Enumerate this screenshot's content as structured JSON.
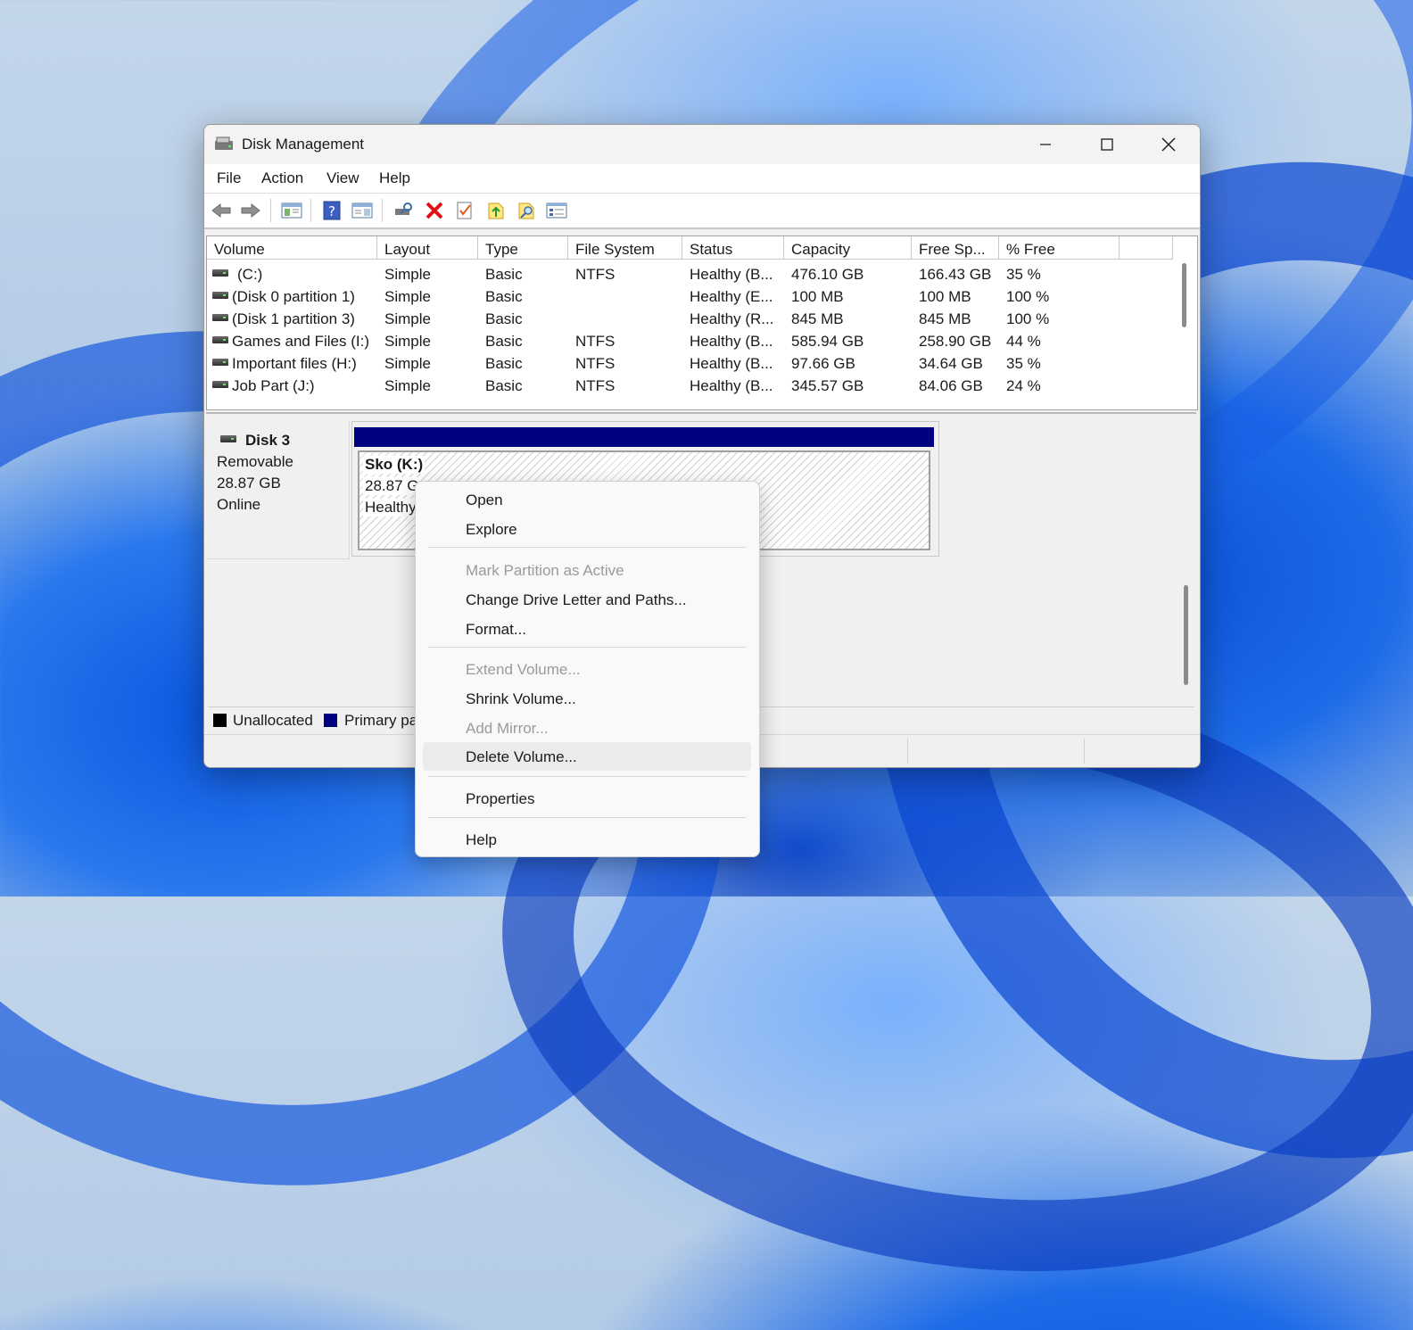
{
  "window": {
    "title": "Disk Management",
    "controls": {
      "minimize": "—",
      "maximize": "□",
      "close": "✕"
    }
  },
  "menu": [
    "File",
    "Action",
    "View",
    "Help"
  ],
  "toolbar_icons": [
    "back-icon",
    "forward-icon",
    "console-tree-icon",
    "help-icon",
    "show-pane-icon",
    "connect-disk-icon",
    "delete-icon",
    "check-icon",
    "import-icon",
    "search-icon",
    "properties-icon"
  ],
  "volume_table": {
    "columns": [
      "Volume",
      "Layout",
      "Type",
      "File System",
      "Status",
      "Capacity",
      "Free Sp...",
      "% Free"
    ],
    "rows": [
      {
        "volume": "(C:)",
        "layout": "Simple",
        "type": "Basic",
        "fs": "NTFS",
        "status": "Healthy (B...",
        "capacity": "476.10 GB",
        "free": "166.43 GB",
        "pct": "35 %"
      },
      {
        "volume": "(Disk 0 partition 1)",
        "layout": "Simple",
        "type": "Basic",
        "fs": "",
        "status": "Healthy (E...",
        "capacity": "100 MB",
        "free": "100 MB",
        "pct": "100 %"
      },
      {
        "volume": "(Disk 1 partition 3)",
        "layout": "Simple",
        "type": "Basic",
        "fs": "",
        "status": "Healthy (R...",
        "capacity": "845 MB",
        "free": "845 MB",
        "pct": "100 %"
      },
      {
        "volume": "Games and Files (I:)",
        "layout": "Simple",
        "type": "Basic",
        "fs": "NTFS",
        "status": "Healthy (B...",
        "capacity": "585.94 GB",
        "free": "258.90 GB",
        "pct": "44 %"
      },
      {
        "volume": "Important files (H:)",
        "layout": "Simple",
        "type": "Basic",
        "fs": "NTFS",
        "status": "Healthy (B...",
        "capacity": "97.66 GB",
        "free": "34.64 GB",
        "pct": "35 %"
      },
      {
        "volume": "Job Part (J:)",
        "layout": "Simple",
        "type": "Basic",
        "fs": "NTFS",
        "status": "Healthy (B...",
        "capacity": "345.57 GB",
        "free": "84.06 GB",
        "pct": "24 %"
      }
    ]
  },
  "disk": {
    "name": "Disk 3",
    "kind": "Removable",
    "size": "28.87 GB",
    "state": "Online",
    "volume_name": "Sko  (K:)",
    "volume_size": "28.87 G",
    "volume_status": "Healthy"
  },
  "legend": {
    "unallocated": "Unallocated",
    "primary": "Primary pa",
    "unallocated_color": "#000000",
    "primary_color": "#000080"
  },
  "context_menu": {
    "open": "Open",
    "explore": "Explore",
    "mark_active": "Mark Partition as Active",
    "change_letter": "Change Drive Letter and Paths...",
    "format": "Format...",
    "extend": "Extend Volume...",
    "shrink": "Shrink Volume...",
    "add_mirror": "Add Mirror...",
    "delete": "Delete Volume...",
    "properties": "Properties",
    "help": "Help"
  }
}
